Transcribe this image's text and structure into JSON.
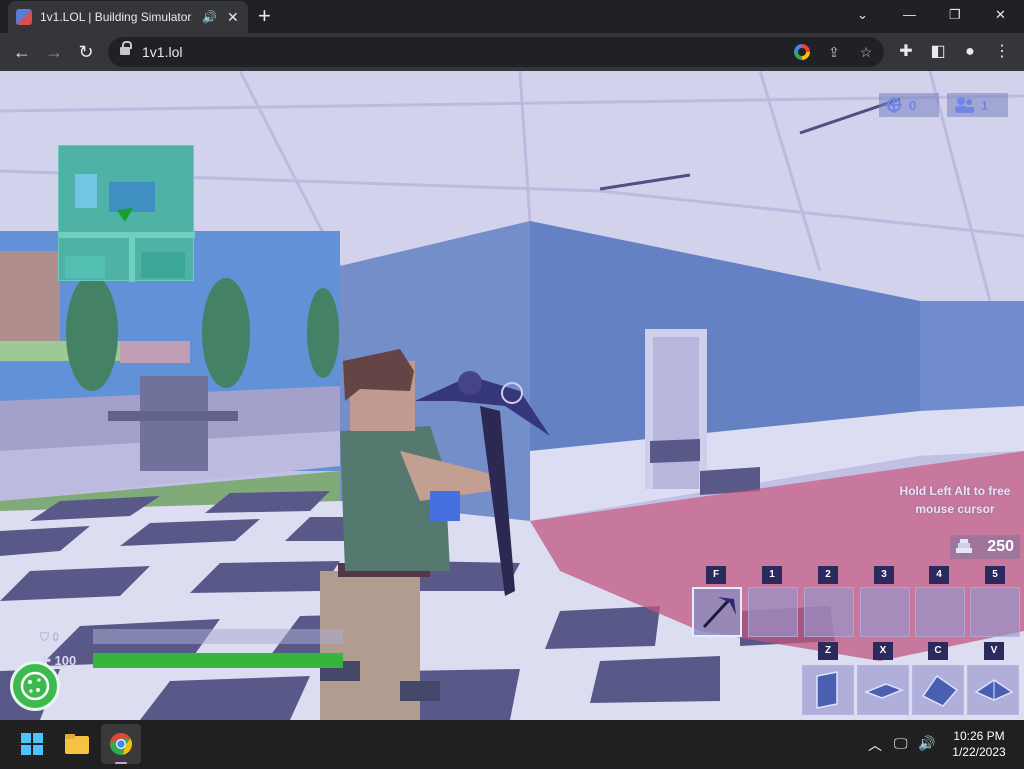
{
  "browser": {
    "tab_title": "1v1.LOL | Building Simulator,",
    "url": "1v1.lol",
    "tab_audio_icon": "speaker-icon",
    "tab_close_icon": "close-icon",
    "new_tab_icon": "plus-icon"
  },
  "game": {
    "hud": {
      "kills": "0",
      "players": "1",
      "kills_icon": "crosshair-icon",
      "players_icon": "players-icon"
    },
    "hint": "Hold Left Alt to free mouse cursor",
    "materials": "250",
    "materials_icon": "materials-icon",
    "hotbar": {
      "keys": [
        "F",
        "1",
        "2",
        "3",
        "4",
        "5"
      ],
      "selected": 0,
      "slot0_item": "pickaxe-icon"
    },
    "build": {
      "keys": [
        "Z",
        "X",
        "C",
        "V"
      ],
      "items": [
        "wall-icon",
        "floor-icon",
        "ramp-icon",
        "cone-icon"
      ]
    },
    "shield": {
      "value": "0",
      "fraction": 0
    },
    "health": {
      "value": "100",
      "fraction": 1.0
    },
    "colors": {
      "health": "#37b43b",
      "accent": "#6f86e8"
    }
  },
  "taskbar": {
    "time": "10:26 PM",
    "date": "1/22/2023"
  }
}
